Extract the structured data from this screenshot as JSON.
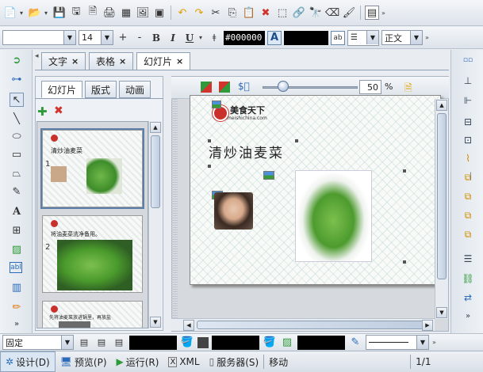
{
  "toolbar2": {
    "font_size": "14",
    "color_hex": "#000000",
    "style_name": "正文"
  },
  "doc_tabs": [
    {
      "label": "文字"
    },
    {
      "label": "表格"
    },
    {
      "label": "幻灯片"
    }
  ],
  "tab_close": "×",
  "slide_panel_tabs": [
    {
      "label": "幻灯片"
    },
    {
      "label": "版式"
    },
    {
      "label": "动画"
    }
  ],
  "thumbnails": [
    {
      "number": "1",
      "title": "清炒油麦菜"
    },
    {
      "number": "2",
      "title": "将油麦菜洗净备用。"
    },
    {
      "number": "",
      "title": "先将油麦菜放进锅里，再放盐"
    }
  ],
  "editor_toolbar": {
    "zoom_value": "50",
    "zoom_unit": "%"
  },
  "slide": {
    "logo_text": "美食天下",
    "logo_url": "meishichina.com",
    "title": "清炒油麦菜"
  },
  "toolbar3": {
    "layout_mode": "固定"
  },
  "status": {
    "design": "设计(D)",
    "preview": "预览(P)",
    "run": "运行(R)",
    "xml": "XML",
    "server": "服务器(S)",
    "mode": "移动",
    "page": "1/1"
  },
  "colors": {
    "accent_blue": "#5b7fa8",
    "delete_red": "#d0342c",
    "add_green": "#2e9a3a"
  }
}
